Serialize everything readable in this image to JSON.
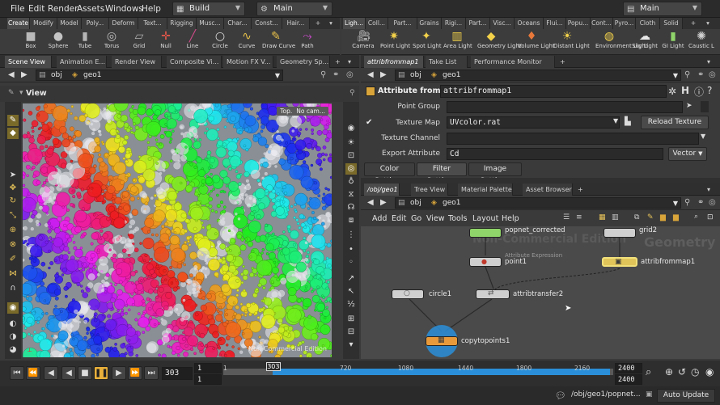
{
  "menubar": {
    "items": [
      "File",
      "Edit",
      "Render",
      "Assets",
      "Windows",
      "Help"
    ],
    "desktop": "Build",
    "context": "Main",
    "right_context": "Main"
  },
  "shelf_left": {
    "tabs": [
      "Create",
      "Modify",
      "Model",
      "Poly...",
      "Deform",
      "Text...",
      "Rigging",
      "Musc...",
      "Char...",
      "Const...",
      "Hair..."
    ],
    "tools": [
      "Box",
      "Sphere",
      "Tube",
      "Torus",
      "Grid",
      "Null",
      "Line",
      "Circle",
      "Curve",
      "Draw Curve",
      "Path"
    ]
  },
  "shelf_right": {
    "tabs": [
      "Ligh...",
      "Coll...",
      "Part...",
      "Grains",
      "Rigi...",
      "Part...",
      "Visc...",
      "Oceans",
      "Flui...",
      "Popu...",
      "Cont...",
      "Pyro...",
      "Cloth",
      "Solid"
    ],
    "tools": [
      "Camera",
      "Point Light",
      "Spot Light",
      "Area Light",
      "Geometry Light",
      "Volume Light",
      "Distant Light",
      "Environment Light",
      "Sky Light",
      "GI Light",
      "Caustic L"
    ]
  },
  "left_pane": {
    "tabs": [
      "Scene View",
      "Animation E...",
      "Render View",
      "Composite Vi...",
      "Motion FX V...",
      "Geometry Sp..."
    ],
    "path": [
      "obj",
      "geo1"
    ],
    "viewer_title": "View",
    "camera_badge": "Top...",
    "cam_label": "No cam...",
    "watermark": "Non-Commercial Edition"
  },
  "param_pane": {
    "tabs": [
      "attribfrommap1",
      "Take List",
      "Performance Monitor"
    ],
    "path": [
      "obj",
      "geo1"
    ],
    "node_type": "Attribute from Map",
    "node_name": "attribfrommap1",
    "fields": [
      {
        "label": "Point Group",
        "value": ""
      },
      {
        "label": "Texture Map",
        "value": "UVcolor.rat"
      },
      {
        "label": "Texture Channel",
        "value": ""
      },
      {
        "label": "Export Attribute",
        "value": "Cd"
      }
    ],
    "reload_button": "Reload Texture",
    "vector_button": "Vector",
    "subtabs": [
      "Color Settings",
      "Filter Settings",
      "Image Settings"
    ]
  },
  "net_pane": {
    "tabs": [
      "/obj/geo1",
      "Tree View",
      "Material Palette",
      "Asset Browser"
    ],
    "path": [
      "obj",
      "geo1"
    ],
    "menu": [
      "Add",
      "Edit",
      "Go",
      "View",
      "Tools",
      "Layout",
      "Help"
    ],
    "watermark": "Non-Commercial Edition",
    "context_label": "Geometry",
    "nodes": [
      {
        "name": "popnet_corrected",
        "color": "#8fd46a"
      },
      {
        "name": "grid2",
        "color": "#cfcfcf"
      },
      {
        "name": "point1",
        "subtitle": "Attribute Expression",
        "color": "#cfcfcf"
      },
      {
        "name": "attribfrommap1",
        "color": "#e0c45a"
      },
      {
        "name": "circle1",
        "color": "#cfcfcf"
      },
      {
        "name": "attribtransfer2",
        "color": "#cfcfcf"
      },
      {
        "name": "copytopoints1",
        "color": "#e89a3a"
      }
    ]
  },
  "timeline": {
    "current_frame": "303",
    "start": "1",
    "start2": "1",
    "end": "2400",
    "end2": "2400",
    "ticks": [
      "1",
      "303",
      "720",
      "1080",
      "1440",
      "1800",
      "2160"
    ]
  },
  "statusbar": {
    "path": "/obj/geo1/popnet...",
    "update_mode": "Auto Update"
  },
  "colors": {
    "accent": "#e0c45a",
    "selection_blue": "#2a8fd8"
  }
}
